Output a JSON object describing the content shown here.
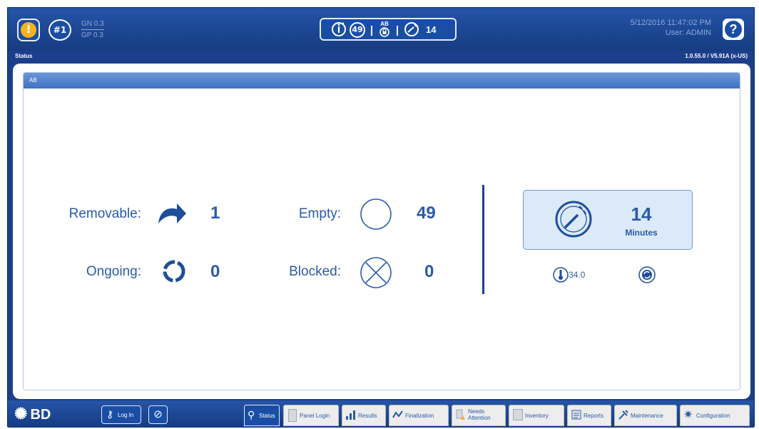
{
  "top": {
    "instrument": "#1",
    "gn": "GN 0.3",
    "gp": "GP 0.3",
    "status_count_1": "49",
    "status_ab": "AB",
    "status_count_2": "14",
    "datetime": "5/12/2016 11:47:02 PM",
    "user": "User: ADMIN",
    "help": "?"
  },
  "header": {
    "title": "Status",
    "version": "1.0.55.0 / V5.91A (x-US)"
  },
  "panel": {
    "title": "AB",
    "removable_label": "Removable:",
    "removable_count": "1",
    "ongoing_label": "Ongoing:",
    "ongoing_count": "0",
    "empty_label": "Empty:",
    "empty_count": "49",
    "blocked_label": "Blocked:",
    "blocked_count": "0",
    "timer_value": "14",
    "timer_unit": "Minutes",
    "temperature": "34.0"
  },
  "bottom": {
    "logo": "BD",
    "login": "Log In",
    "tabs": [
      {
        "label": "Status",
        "icon": "wrench-icon"
      },
      {
        "label": "Panel Login",
        "icon": "panel-icon"
      },
      {
        "label": "Results",
        "icon": "results-icon"
      },
      {
        "label": "Finalization",
        "icon": "finalization-icon"
      },
      {
        "label": "Needs Attention",
        "icon": "attention-icon"
      },
      {
        "label": "Inventory",
        "icon": "inventory-icon"
      },
      {
        "label": "Reports",
        "icon": "reports-icon"
      },
      {
        "label": "Maintenance",
        "icon": "maintenance-icon"
      },
      {
        "label": "Configuration",
        "icon": "configuration-icon"
      }
    ]
  },
  "colors": {
    "brand_dark": "#1c3f8c",
    "brand": "#1a4ea5",
    "text_blue": "#2b5aa8",
    "alert": "#f5b221"
  }
}
